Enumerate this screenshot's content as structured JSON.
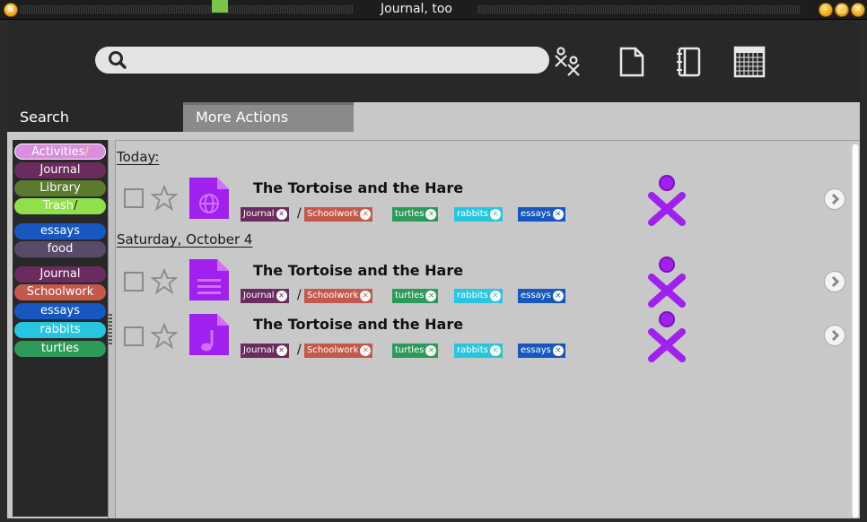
{
  "window": {
    "title": "Journal, too",
    "menu_button": "≡",
    "minimize_button": "–",
    "maximize_button": "□",
    "close_button": "✕"
  },
  "toolbar": {
    "search_placeholder": "",
    "search_value": "",
    "icons": [
      "search-icon",
      "xo-buddies-icon",
      "document-icon",
      "journal-book-icon",
      "calendar-icon"
    ]
  },
  "tabs": [
    {
      "label": "Search",
      "active": true
    },
    {
      "label": "More Actions",
      "active": false
    }
  ],
  "sidebar": {
    "items": [
      {
        "label": "Activities",
        "suffix": "/",
        "color": "#d98ee0",
        "selected": true
      },
      {
        "label": "Journal",
        "suffix": "",
        "color": "#6a2b5e"
      },
      {
        "label": "Library",
        "suffix": "",
        "color": "#5a7a2e"
      },
      {
        "label": "Trash",
        "suffix": "/",
        "color": "#8fe04a"
      },
      {
        "label": "essays",
        "suffix": "",
        "color": "#1758c0"
      },
      {
        "label": "food",
        "suffix": "",
        "color": "#5a4a6a"
      },
      {
        "label": "Journal",
        "suffix": "",
        "color": "#6a2b5e"
      },
      {
        "label": "Schoolwork",
        "suffix": "",
        "color": "#c4584b"
      },
      {
        "label": "essays",
        "suffix": "",
        "color": "#1758c0"
      },
      {
        "label": "rabbits",
        "suffix": "",
        "color": "#27c6e0"
      },
      {
        "label": "turtles",
        "suffix": "",
        "color": "#2e9a5a"
      }
    ]
  },
  "groups": [
    {
      "heading": "Today:",
      "entries": [
        {
          "title": "The Tortoise and the Hare",
          "icon": "web-document-icon",
          "tags": [
            "Journal",
            "Schoolwork",
            "turtles",
            "rabbits",
            "essays"
          ],
          "separator": "/"
        }
      ]
    },
    {
      "heading": "Saturday, October 4",
      "entries": [
        {
          "title": "The Tortoise and the Hare",
          "icon": "text-document-icon",
          "tags": [
            "Journal",
            "Schoolwork",
            "turtles",
            "rabbits",
            "essays"
          ],
          "separator": "/"
        },
        {
          "title": "The Tortoise and the Hare",
          "icon": "music-document-icon",
          "tags": [
            "Journal",
            "Schoolwork",
            "turtles",
            "rabbits",
            "essays"
          ],
          "separator": "/"
        }
      ]
    }
  ],
  "colors": {
    "accent_green": "#7bc44a",
    "toolbar_bg": "#282828",
    "content_bg": "#c8c8c8",
    "activity_purple": "#a020f0"
  }
}
